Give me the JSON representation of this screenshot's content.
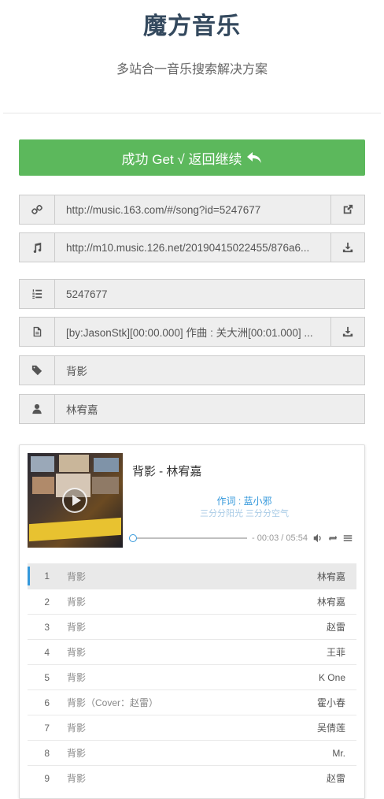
{
  "header": {
    "title": "魔方音乐",
    "subtitle": "多站合一音乐搜索解决方案"
  },
  "success_button": {
    "label": "成功 Get √ 返回继续"
  },
  "fields": {
    "song_link": "http://music.163.com/#/song?id=5247677",
    "audio_url": "http://m10.music.126.net/20190415022455/876a6...",
    "song_id": "5247677",
    "lyrics": "[by:JasonStk][00:00.000] 作曲 : 关大洲[00:01.000] ...",
    "song_name": "背影",
    "artist": "林宥嘉"
  },
  "player": {
    "title": "背影 - 林宥嘉",
    "lyric_current": "作词 : 蓝小邪",
    "lyric_next": "三分分阳光 三分分空气",
    "time": "- 00:03 / 05:54",
    "progress": 0.01
  },
  "playlist": [
    {
      "index": "1",
      "name": "背影",
      "artist": "林宥嘉",
      "active": true
    },
    {
      "index": "2",
      "name": "背影",
      "artist": "林宥嘉"
    },
    {
      "index": "3",
      "name": "背影",
      "artist": "赵雷"
    },
    {
      "index": "4",
      "name": "背影",
      "artist": "王菲"
    },
    {
      "index": "5",
      "name": "背影",
      "artist": "K One"
    },
    {
      "index": "6",
      "name": "背影（Cover：赵雷）",
      "artist": "霍小春"
    },
    {
      "index": "7",
      "name": "背影",
      "artist": "吴倩莲"
    },
    {
      "index": "8",
      "name": "背影",
      "artist": "Mr."
    },
    {
      "index": "9",
      "name": "背影",
      "artist": "赵雷"
    }
  ],
  "colors": {
    "success": "#5cb85c",
    "accent": "#3498db",
    "title": "#34495e"
  },
  "icons": {
    "link": "link-icon",
    "music": "music-note-icon",
    "id": "list-ordered-icon",
    "lyrics": "file-text-icon",
    "name": "tag-icon",
    "artist": "user-icon",
    "open": "external-link-icon",
    "download": "download-icon",
    "back": "reply-icon"
  }
}
